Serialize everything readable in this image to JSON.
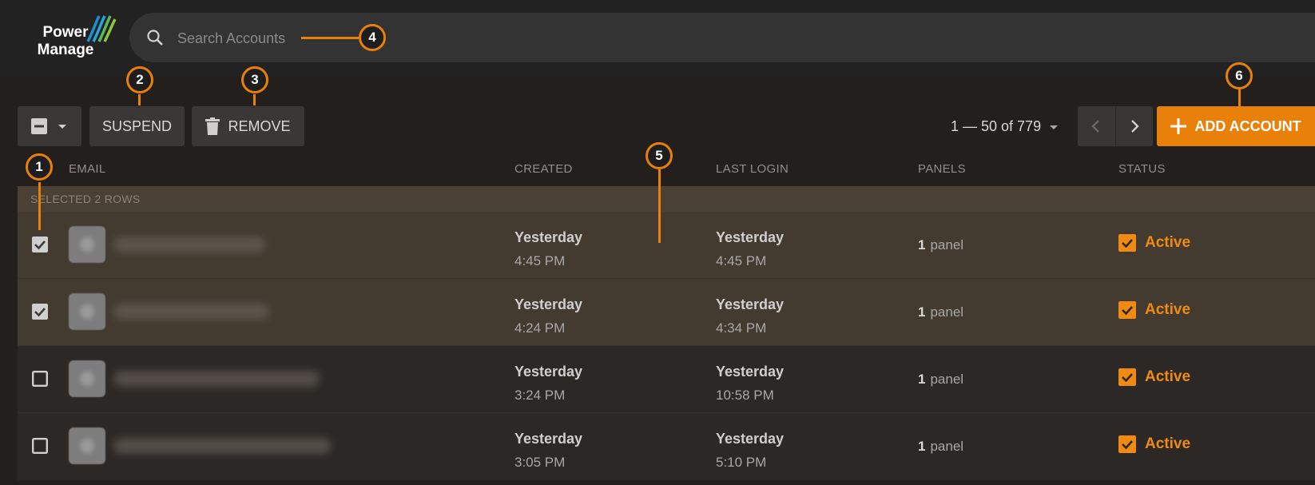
{
  "app": {
    "logo_line1": "Power",
    "logo_line2": "Manage"
  },
  "search": {
    "placeholder": "Search Accounts"
  },
  "toolbar": {
    "suspend_label": "SUSPEND",
    "remove_label": "REMOVE",
    "add_label": "ADD ACCOUNT",
    "pager_text": "1 — 50 of 779"
  },
  "columns": {
    "email": "EMAIL",
    "created": "CREATED",
    "last_login": "LAST LOGIN",
    "panels": "PANELS",
    "status": "STATUS"
  },
  "selection": {
    "text": "SELECTED 2 ROWS"
  },
  "rows": [
    {
      "checked": true,
      "created_day": "Yesterday",
      "created_time": "4:45 PM",
      "login_day": "Yesterday",
      "login_time": "4:45 PM",
      "panels_count": "1",
      "panels_unit": "panel",
      "status": "Active"
    },
    {
      "checked": true,
      "created_day": "Yesterday",
      "created_time": "4:24 PM",
      "login_day": "Yesterday",
      "login_time": "4:34 PM",
      "panels_count": "1",
      "panels_unit": "panel",
      "status": "Active"
    },
    {
      "checked": false,
      "created_day": "Yesterday",
      "created_time": "3:24 PM",
      "login_day": "Yesterday",
      "login_time": "10:58 PM",
      "panels_count": "1",
      "panels_unit": "panel",
      "status": "Active"
    },
    {
      "checked": false,
      "created_day": "Yesterday",
      "created_time": "3:05 PM",
      "login_day": "Yesterday",
      "login_time": "5:10 PM",
      "panels_count": "1",
      "panels_unit": "panel",
      "status": "Active"
    }
  ],
  "callouts": [
    "1",
    "2",
    "3",
    "4",
    "5",
    "6"
  ],
  "colors": {
    "accent": "#e8800a",
    "status_active": "#f08a12",
    "selected_row": "#433a30"
  }
}
